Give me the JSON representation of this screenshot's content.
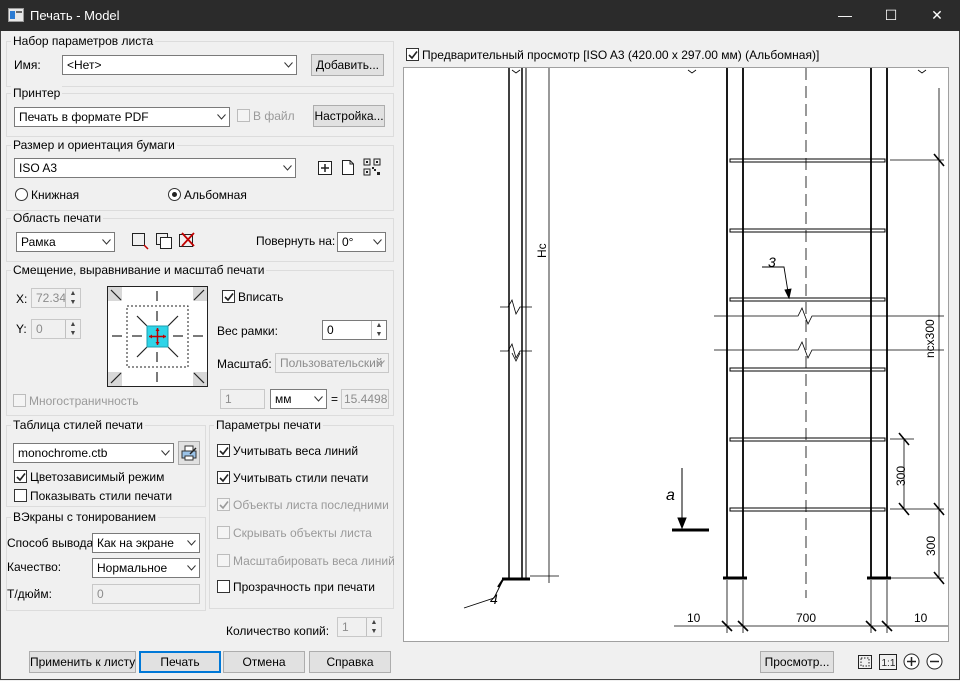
{
  "window": {
    "title": "Печать - Model",
    "minimize_glyph": "—",
    "maximize_glyph": "☐",
    "close_glyph": "✕"
  },
  "page_setup": {
    "title": "Набор параметров листа",
    "name_label": "Имя:",
    "name_value": "<Нет>",
    "add_button": "Добавить..."
  },
  "printer": {
    "title": "Принтер",
    "name_value": "Печать в формате PDF",
    "to_file_label": "В файл",
    "to_file_checked": false,
    "settings_button": "Настройка..."
  },
  "paper": {
    "title": "Размер и ориентация бумаги",
    "size_value": "ISO A3",
    "portrait_label": "Книжная",
    "landscape_label": "Альбомная",
    "orientation": "landscape"
  },
  "plot_area": {
    "title": "Область печати",
    "what_value": "Рамка",
    "rotate_label": "Повернуть на:",
    "rotate_value": "0°"
  },
  "offset": {
    "title": "Смещение, выравнивание и масштаб печати",
    "x_label": "X:",
    "x_value": "72.34",
    "y_label": "Y:",
    "y_value": "0",
    "fit_label": "Вписать",
    "fit_checked": true,
    "frame_weight_label": "Вес рамки:",
    "frame_weight_value": "0",
    "scale_label": "Масштаб:",
    "scale_value": "Пользовательский",
    "multipage_label": "Многостраничность",
    "scale_num": "1",
    "scale_unit": "мм",
    "equals": "=",
    "scale_den": "15.4498"
  },
  "plot_style": {
    "title": "Таблица стилей печати",
    "table_value": "monochrome.ctb",
    "color_dependent_label": "Цветозависимый режим",
    "color_dependent_checked": true,
    "show_styles_label": "Показывать стили печати",
    "show_styles_checked": false
  },
  "shaded": {
    "title": "ВЭкраны с тонированием",
    "output_label": "Способ вывода:",
    "output_value": "Как на экране",
    "quality_label": "Качество:",
    "quality_value": "Нормальное",
    "dpi_label": "Т/дюйм:",
    "dpi_value": "0"
  },
  "options": {
    "title": "Параметры печати",
    "items": [
      {
        "label": "Учитывать веса линий",
        "checked": true,
        "disabled": false
      },
      {
        "label": "Учитывать стили печати",
        "checked": true,
        "disabled": false
      },
      {
        "label": "Объекты листа последними",
        "checked": true,
        "disabled": true
      },
      {
        "label": "Скрывать объекты листа",
        "checked": false,
        "disabled": true
      },
      {
        "label": "Масштабировать веса линий",
        "checked": false,
        "disabled": true
      },
      {
        "label": "Прозрачность при печати",
        "checked": false,
        "disabled": false
      }
    ]
  },
  "copies": {
    "label": "Количество копий:",
    "value": "1"
  },
  "buttons": {
    "apply": "Применить к листу",
    "print": "Печать",
    "cancel": "Отмена",
    "help": "Справка",
    "preview": "Просмотр..."
  },
  "preview": {
    "label": "Предварительный просмотр [ISO A3 (420.00 x 297.00 мм) (Альбомная)]",
    "checked": true,
    "drawing_labels": {
      "hc": "Hc",
      "ncx": "nсx300",
      "dim_300_top": "300",
      "dim_300_bottom": "300",
      "dim_10_left": "10",
      "dim_700": "700",
      "dim_10_right": "10",
      "mark_3": "3",
      "mark_4": "4",
      "mark_a": "а"
    }
  },
  "toolbar_icon_names": [
    "extents-icon",
    "one-to-one-icon",
    "zoom-in-icon",
    "zoom-out-icon"
  ]
}
